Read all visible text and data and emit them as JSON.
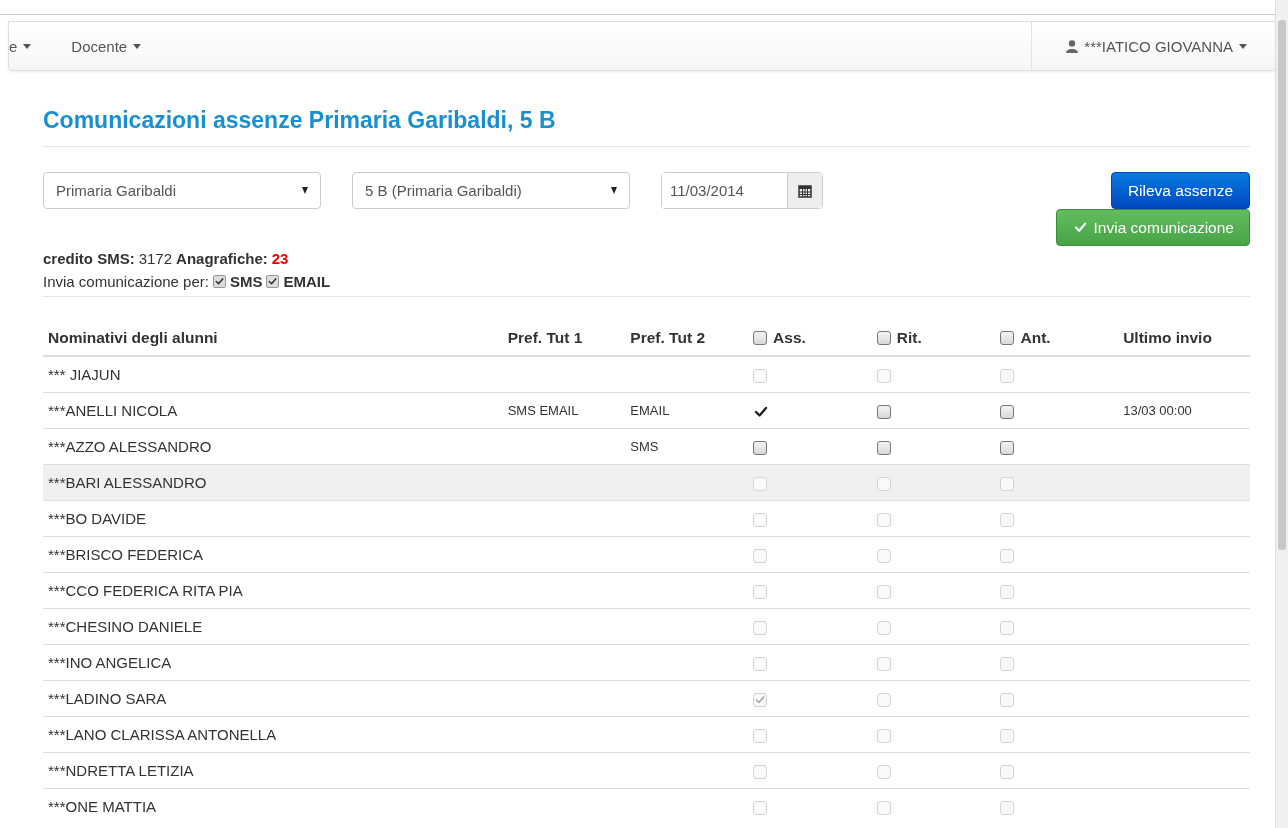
{
  "navbar": {
    "menus": [
      {
        "label": "e"
      },
      {
        "label": "Docente"
      }
    ],
    "user": "***IATICO GIOVANNA"
  },
  "title": "Comunicazioni assenze Primaria Garibaldi, 5 B",
  "filters": {
    "school": "Primaria Garibaldi",
    "class": "5 B (Primaria Garibaldi)",
    "date": "11/03/2014"
  },
  "buttons": {
    "detect": "Rileva assenze",
    "send": "Invia comunicazione"
  },
  "stats": [
    {
      "label": "credito SMS:",
      "value": "3172",
      "alert": false
    },
    {
      "label": "Anagrafiche:",
      "value": "23",
      "alert": true
    }
  ],
  "send_via": {
    "label": "Invia comunicazione per:",
    "channels": [
      {
        "label": "SMS",
        "checked": true
      },
      {
        "label": "EMAIL",
        "checked": true
      }
    ]
  },
  "table": {
    "columns": [
      {
        "label": "Nominativi degli alunni",
        "kind": "text"
      },
      {
        "label": "Pref. Tut 1",
        "kind": "text"
      },
      {
        "label": "Pref. Tut 2",
        "kind": "text"
      },
      {
        "label": "Ass.",
        "kind": "check",
        "checked": false
      },
      {
        "label": "Rit.",
        "kind": "check",
        "checked": false
      },
      {
        "label": "Ant.",
        "kind": "check",
        "checked": false
      },
      {
        "label": "Ultimo invio",
        "kind": "text"
      }
    ],
    "rows": [
      {
        "name": "*** JIAJUN",
        "pref1": "",
        "pref2": "",
        "selected": false,
        "checks": [
          {
            "kind": "box",
            "checked": false,
            "disabled": true
          },
          {
            "kind": "box",
            "checked": false,
            "disabled": true
          },
          {
            "kind": "box",
            "checked": false,
            "disabled": true
          }
        ],
        "last": ""
      },
      {
        "name": "***ANELLI NICOLA",
        "pref1": "SMS EMAIL",
        "pref2": "EMAIL",
        "selected": false,
        "checks": [
          {
            "kind": "tick",
            "checked": true
          },
          {
            "kind": "box",
            "checked": false,
            "disabled": false
          },
          {
            "kind": "box",
            "checked": false,
            "disabled": false
          }
        ],
        "last": "13/03 00:00"
      },
      {
        "name": "***AZZO ALESSANDRO",
        "pref1": "",
        "pref2": "SMS",
        "selected": false,
        "checks": [
          {
            "kind": "box",
            "checked": false,
            "disabled": false
          },
          {
            "kind": "box",
            "checked": false,
            "disabled": false
          },
          {
            "kind": "box",
            "checked": false,
            "disabled": false
          }
        ],
        "last": ""
      },
      {
        "name": "***BARI ALESSANDRO",
        "pref1": "",
        "pref2": "",
        "selected": true,
        "checks": [
          {
            "kind": "box",
            "checked": false,
            "disabled": true
          },
          {
            "kind": "box",
            "checked": false,
            "disabled": true
          },
          {
            "kind": "box",
            "checked": false,
            "disabled": true
          }
        ],
        "last": ""
      },
      {
        "name": "***BO DAVIDE",
        "pref1": "",
        "pref2": "",
        "selected": false,
        "checks": [
          {
            "kind": "box",
            "checked": false,
            "disabled": true
          },
          {
            "kind": "box",
            "checked": false,
            "disabled": true
          },
          {
            "kind": "box",
            "checked": false,
            "disabled": true
          }
        ],
        "last": ""
      },
      {
        "name": "***BRISCO FEDERICA",
        "pref1": "",
        "pref2": "",
        "selected": false,
        "checks": [
          {
            "kind": "box",
            "checked": false,
            "disabled": true
          },
          {
            "kind": "box",
            "checked": false,
            "disabled": true
          },
          {
            "kind": "box",
            "checked": false,
            "disabled": true
          }
        ],
        "last": ""
      },
      {
        "name": "***CCO FEDERICA RITA PIA",
        "pref1": "",
        "pref2": "",
        "selected": false,
        "checks": [
          {
            "kind": "box",
            "checked": false,
            "disabled": true
          },
          {
            "kind": "box",
            "checked": false,
            "disabled": true
          },
          {
            "kind": "box",
            "checked": false,
            "disabled": true
          }
        ],
        "last": ""
      },
      {
        "name": "***CHESINO DANIELE",
        "pref1": "",
        "pref2": "",
        "selected": false,
        "checks": [
          {
            "kind": "box",
            "checked": false,
            "disabled": true
          },
          {
            "kind": "box",
            "checked": false,
            "disabled": true
          },
          {
            "kind": "box",
            "checked": false,
            "disabled": true
          }
        ],
        "last": ""
      },
      {
        "name": "***INO ANGELICA",
        "pref1": "",
        "pref2": "",
        "selected": false,
        "checks": [
          {
            "kind": "box",
            "checked": false,
            "disabled": true
          },
          {
            "kind": "box",
            "checked": false,
            "disabled": true
          },
          {
            "kind": "box",
            "checked": false,
            "disabled": true
          }
        ],
        "last": ""
      },
      {
        "name": "***LADINO SARA",
        "pref1": "",
        "pref2": "",
        "selected": false,
        "checks": [
          {
            "kind": "box",
            "checked": true,
            "disabled": true
          },
          {
            "kind": "box",
            "checked": false,
            "disabled": true
          },
          {
            "kind": "box",
            "checked": false,
            "disabled": true
          }
        ],
        "last": ""
      },
      {
        "name": "***LANO CLARISSA ANTONELLA",
        "pref1": "",
        "pref2": "",
        "selected": false,
        "checks": [
          {
            "kind": "box",
            "checked": false,
            "disabled": true
          },
          {
            "kind": "box",
            "checked": false,
            "disabled": true
          },
          {
            "kind": "box",
            "checked": false,
            "disabled": true
          }
        ],
        "last": ""
      },
      {
        "name": "***NDRETTA LETIZIA",
        "pref1": "",
        "pref2": "",
        "selected": false,
        "checks": [
          {
            "kind": "box",
            "checked": false,
            "disabled": true
          },
          {
            "kind": "box",
            "checked": false,
            "disabled": true
          },
          {
            "kind": "box",
            "checked": false,
            "disabled": true
          }
        ],
        "last": ""
      },
      {
        "name": "***ONE MATTIA",
        "pref1": "",
        "pref2": "",
        "selected": false,
        "checks": [
          {
            "kind": "box",
            "checked": false,
            "disabled": true
          },
          {
            "kind": "box",
            "checked": false,
            "disabled": true
          },
          {
            "kind": "box",
            "checked": false,
            "disabled": true
          }
        ],
        "last": ""
      }
    ]
  }
}
